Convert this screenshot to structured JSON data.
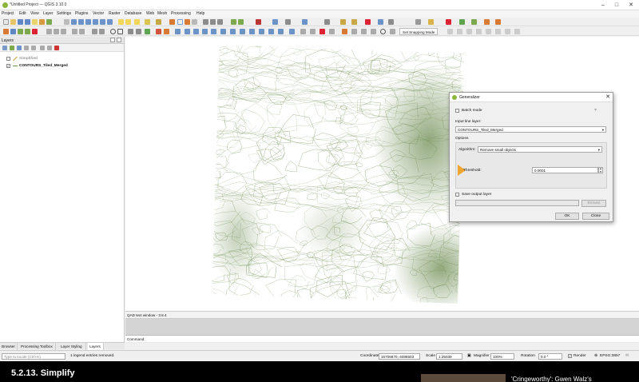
{
  "window": {
    "title": "*Untitled Project — QGIS 3.10.0",
    "minimize": "–",
    "maximize": "□",
    "close": "✕"
  },
  "menu": [
    "Project",
    "Edit",
    "View",
    "Layer",
    "Settings",
    "Plugins",
    "Vector",
    "Raster",
    "Database",
    "Web",
    "Mesh",
    "Processing",
    "Help"
  ],
  "toolbar": {
    "snapping_label": "Set Snapping Mode"
  },
  "layers_panel": {
    "title": "Layers",
    "items": [
      {
        "name": "Simplified",
        "checked": false
      },
      {
        "name": "CONTOURS_Tiled_Merged",
        "checked": true
      }
    ]
  },
  "panel_tabs": [
    "Browser",
    "Processing Toolbox",
    "Layer Styling",
    "Layers"
  ],
  "qad_window": {
    "title": "QAD text window - 3.8.4",
    "command_label": "Command:"
  },
  "statusbar": {
    "locate_placeholder": "Type to locate (Ctrl+K)",
    "message": "1 legend entries removed.",
    "coordinate_label": "Coordinate",
    "coordinate_value": "16706670,-4086503",
    "scale_label": "Scale",
    "scale_value": "1:25039",
    "magnifier_label": "Magnifier",
    "magnifier_value": "100%",
    "rotation_label": "Rotation",
    "rotation_value": "0.0 °",
    "render_label": "Render",
    "crs_label": "EPSG:3857"
  },
  "dialog": {
    "title": "Generalizer",
    "batch_mode_label": "Batch mode",
    "help_glyph": "?",
    "input_layer_label": "Input line layer:",
    "input_layer_value": "CONTOURS_Tiled_Merged",
    "options_label": "Options",
    "algorithm_label": "Algorithm:",
    "algorithm_value": "Remove small objects",
    "threshold_label": "Threshold:",
    "threshold_value": "0.0001",
    "save_output_label": "Save output layer",
    "browse_label": "Browse",
    "ok_label": "OK",
    "close_label": "Close"
  },
  "video_footer": {
    "title": "5.2.13. Simplify",
    "suggestion_title": "'Cringeworthy': Gwen Walz's"
  },
  "colors": {
    "contour": "#7d9a62",
    "accent_pointer": "#f0a530",
    "qgis_green": "#8bb63b"
  }
}
